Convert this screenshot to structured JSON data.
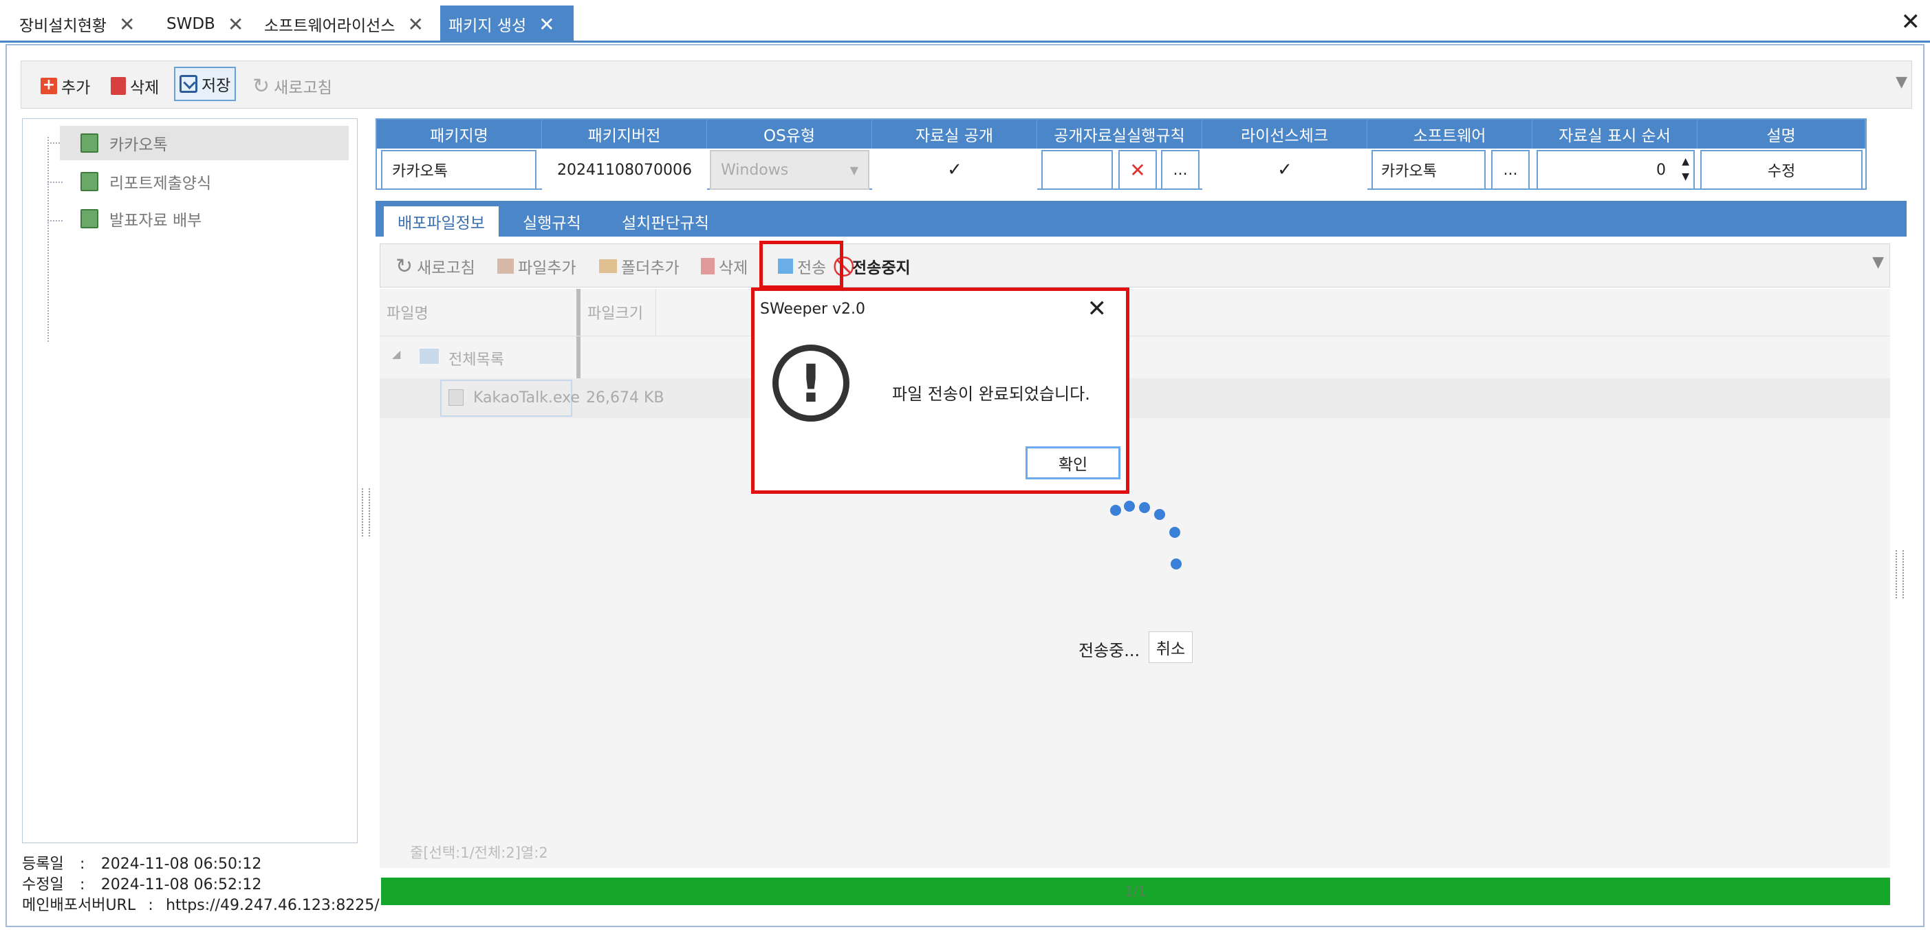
{
  "tabs": [
    {
      "label": "장비설치현황"
    },
    {
      "label": "SWDB"
    },
    {
      "label": "소프트웨어라이선스"
    },
    {
      "label": "패키지 생성"
    }
  ],
  "toolbar": {
    "add": "추가",
    "delete": "삭제",
    "save": "저장",
    "refresh": "새로고침"
  },
  "tree": {
    "items": [
      "카카오톡",
      "리포트제출양식",
      "발표자료 배부"
    ]
  },
  "info": {
    "registered_label": "등록일",
    "registered": "2024-11-08 06:50:12",
    "modified_label": "수정일",
    "modified": "2024-11-08 06:52:12",
    "server_label": "메인배포서버URL",
    "server": "https://49.247.46.123:8225/"
  },
  "grid": {
    "headers": [
      "패키지명",
      "패키지버전",
      "OS유형",
      "자료실 공개",
      "공개자료실실행규칙",
      "라이선스체크",
      "소프트웨어",
      "자료실 표시 순서",
      "설명"
    ],
    "name": "카카오톡",
    "version": "20241108070006",
    "os": "Windows",
    "software": "카카오톡",
    "order": "0",
    "edit_label": "수정",
    "dots": "..."
  },
  "inner_tabs": [
    "배포파일정보",
    "실행규칙",
    "설치판단규칙"
  ],
  "inner_toolbar": {
    "refresh": "새로고침",
    "add_file": "파일추가",
    "add_folder": "폴더추가",
    "delete": "삭제",
    "send": "전송",
    "stop": "전송중지"
  },
  "file_list": {
    "col_name": "파일명",
    "col_size": "파일크기",
    "root": "전체목록",
    "file_name": "KakaoTalk.exe",
    "file_size": "26,674 KB"
  },
  "status_line": "줄[선택:1/전체:2]열:2",
  "progress": {
    "label": "1/1",
    "fraction": 1.0
  },
  "sending": {
    "label": "전송중...",
    "cancel": "취소"
  },
  "dialog": {
    "title": "SWeeper v2.0",
    "message": "파일 전송이 완료되었습니다.",
    "ok": "확인"
  },
  "colors": {
    "accent": "#4a86c8",
    "highlight": "#e01010",
    "progress": "#16a72a",
    "spinner": "#3a7fd8"
  }
}
